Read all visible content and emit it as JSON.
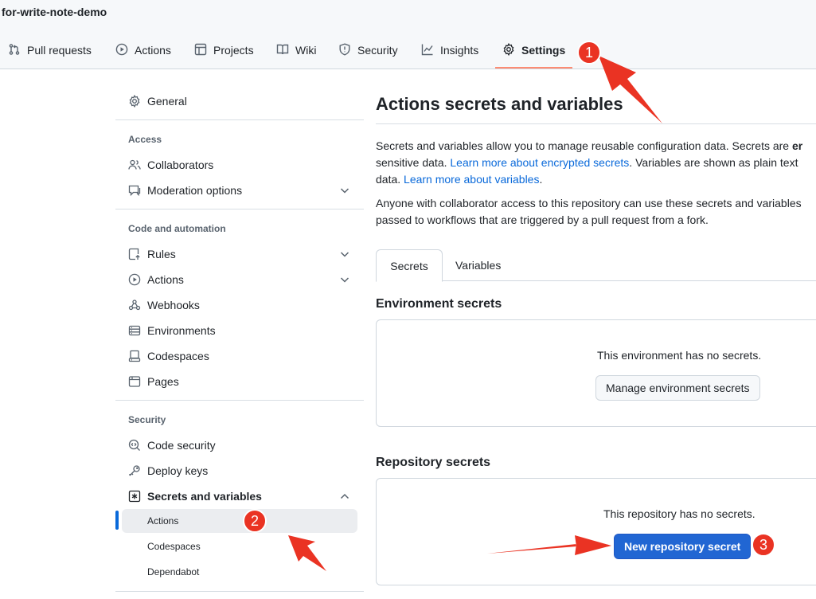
{
  "repo": {
    "title": "for-write-note-demo"
  },
  "nav": {
    "tabs": [
      {
        "label": "Pull requests",
        "icon": "git-pull-request-icon"
      },
      {
        "label": "Actions",
        "icon": "play-icon"
      },
      {
        "label": "Projects",
        "icon": "table-icon"
      },
      {
        "label": "Wiki",
        "icon": "book-icon"
      },
      {
        "label": "Security",
        "icon": "shield-icon"
      },
      {
        "label": "Insights",
        "icon": "graph-icon"
      },
      {
        "label": "Settings",
        "icon": "gear-icon",
        "selected": true
      }
    ],
    "selected_underline_color": "#fd8c73"
  },
  "sidebar": {
    "general": "General",
    "access_heading": "Access",
    "collaborators": "Collaborators",
    "moderation": "Moderation options",
    "code_heading": "Code and automation",
    "rules": "Rules",
    "actions": "Actions",
    "webhooks": "Webhooks",
    "environments": "Environments",
    "codespaces": "Codespaces",
    "pages": "Pages",
    "security_heading": "Security",
    "code_security": "Code security",
    "deploy_keys": "Deploy keys",
    "secrets_vars": "Secrets and variables",
    "sub": {
      "actions": "Actions",
      "codespaces": "Codespaces",
      "dependabot": "Dependabot"
    },
    "active_color": "#0969da"
  },
  "main": {
    "title": "Actions secrets and variables",
    "intro": {
      "line1_a": "Secrets and variables allow you to manage reusable configuration data. Secrets are ",
      "line1_b": "er",
      "line2_a": "sensitive data. ",
      "link1": "Learn more about encrypted secrets",
      "line2_b": ". Variables are shown as plain text",
      "line3_a": "data. ",
      "link2": "Learn more about variables",
      "line3_b": "."
    },
    "access_note": {
      "line1": "Anyone with collaborator access to this repository can use these secrets and variables",
      "line2": "passed to workflows that are triggered by a pull request from a fork."
    },
    "tabs": {
      "secrets": "Secrets",
      "variables": "Variables"
    },
    "env": {
      "heading": "Environment secrets",
      "empty": "This environment has no secrets.",
      "button": "Manage environment secrets"
    },
    "repo": {
      "heading": "Repository secrets",
      "empty": "This repository has no secrets.",
      "button": "New repository secret"
    },
    "primary_color": "#2166d3"
  },
  "annotations": {
    "badges": [
      "1",
      "2",
      "3"
    ],
    "color": "#ea3323"
  }
}
